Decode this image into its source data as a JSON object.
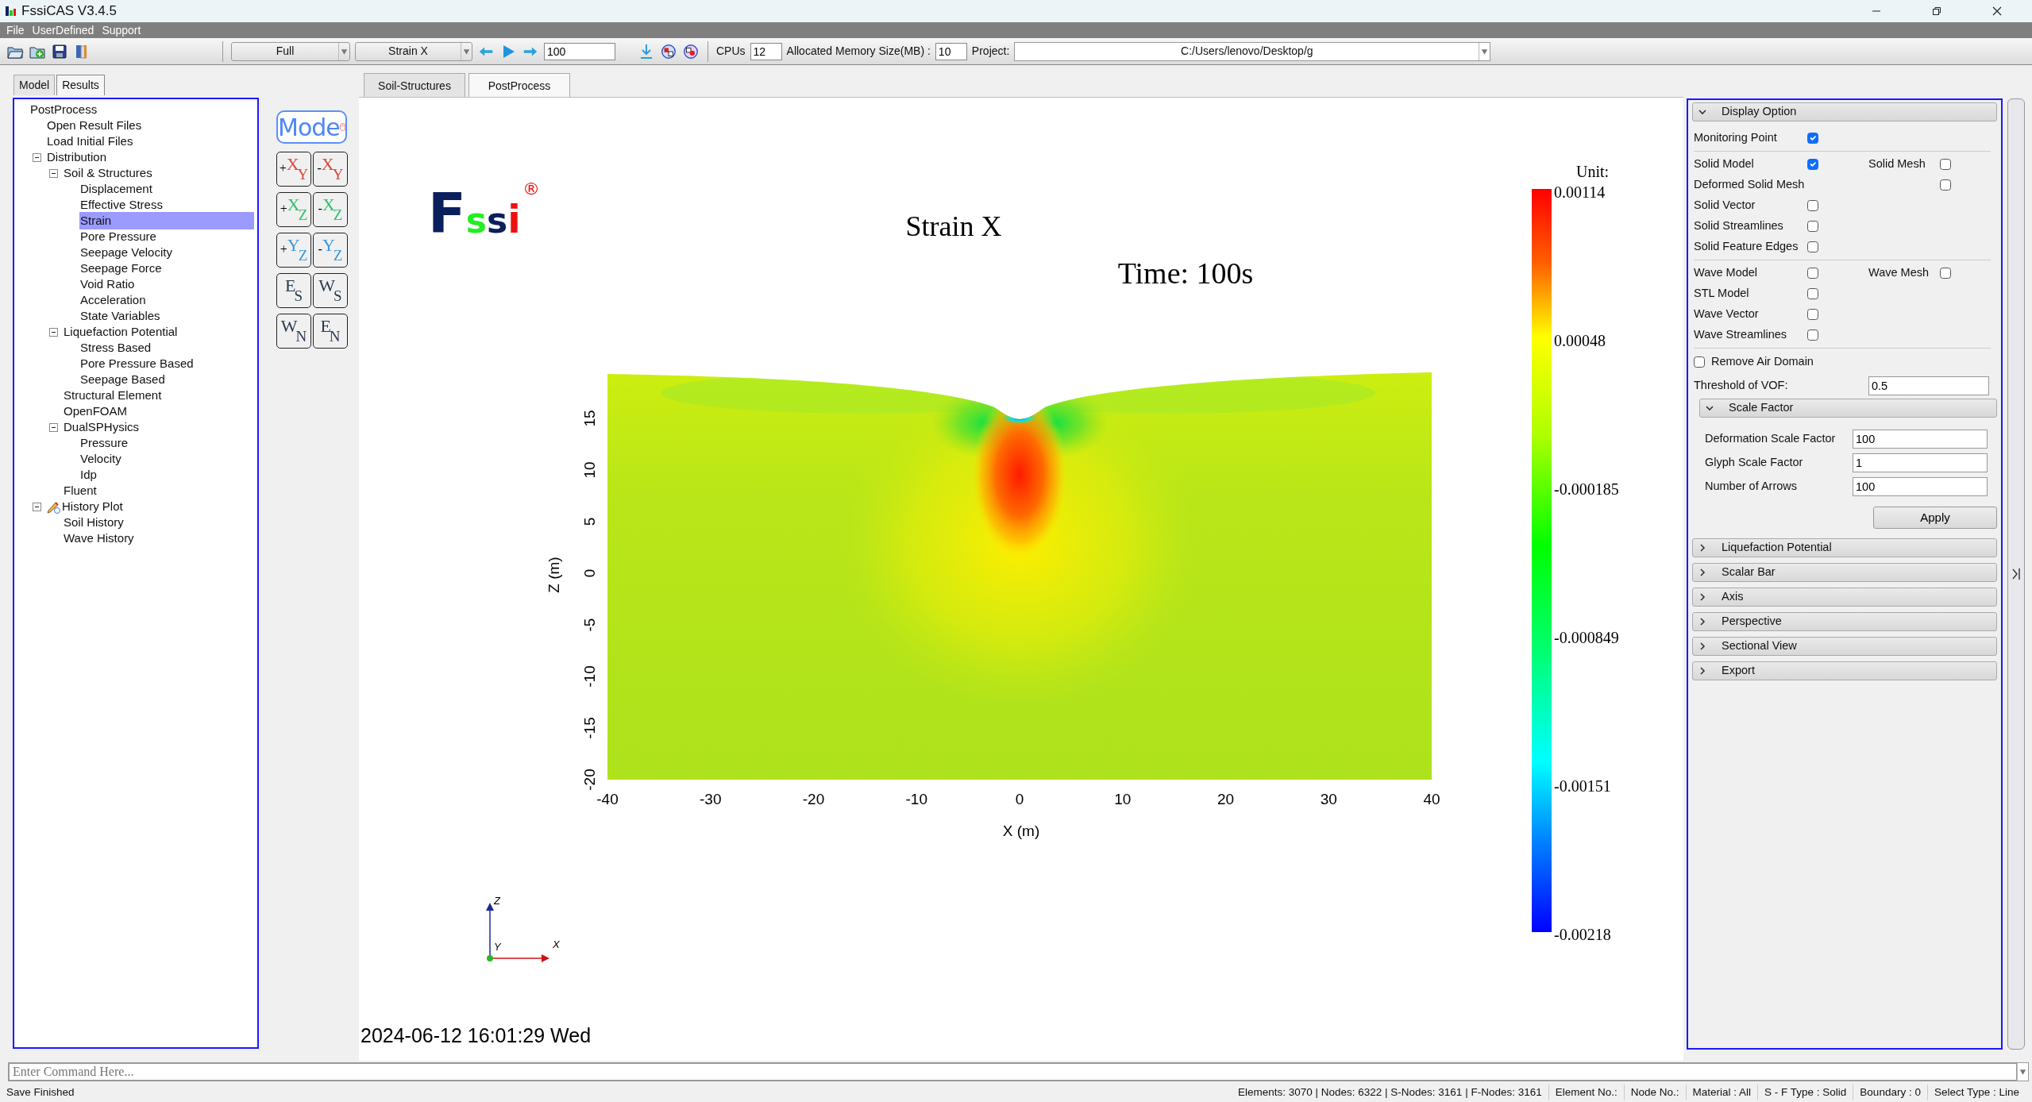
{
  "window": {
    "title": "FssiCAS V3.4.5"
  },
  "menu": [
    "File",
    "UserDefined",
    "Support"
  ],
  "toolbar": {
    "display_mode": "Full",
    "variable": "Strain X",
    "frame": "100",
    "cpus_label": "CPUs",
    "cpus": "12",
    "memory_label": "Allocated Memory Size(MB) :",
    "memory": "10",
    "project_label": "Project:",
    "project": "C:/Users/lenovo/Desktop/g"
  },
  "left_tabs": [
    {
      "label": "Model",
      "selected": false
    },
    {
      "label": "Results",
      "selected": true
    }
  ],
  "tree": [
    {
      "label": "PostProcess",
      "selected": false,
      "children": [
        {
          "label": "Open Result Files",
          "selected": false
        },
        {
          "label": "Load Initial Files",
          "selected": false
        },
        {
          "label": "Distribution",
          "selected": false,
          "expanded": true,
          "children": [
            {
              "label": "Soil & Structures",
              "selected": false,
              "expanded": true,
              "children": [
                {
                  "label": "Displacement",
                  "selected": false
                },
                {
                  "label": "Effective Stress",
                  "selected": false
                },
                {
                  "label": "Strain",
                  "selected": true
                },
                {
                  "label": "Pore Pressure",
                  "selected": false
                },
                {
                  "label": "Seepage Velocity",
                  "selected": false
                },
                {
                  "label": "Seepage Force",
                  "selected": false
                },
                {
                  "label": "Void Ratio",
                  "selected": false
                },
                {
                  "label": "Acceleration",
                  "selected": false
                },
                {
                  "label": "State Variables",
                  "selected": false
                }
              ]
            },
            {
              "label": "Liquefaction Potential",
              "selected": false,
              "expanded": true,
              "children": [
                {
                  "label": "Stress Based",
                  "selected": false
                },
                {
                  "label": "Pore Pressure Based",
                  "selected": false
                },
                {
                  "label": "Seepage Based",
                  "selected": false
                }
              ]
            },
            {
              "label": "Structural Element",
              "selected": false
            },
            {
              "label": "OpenFOAM",
              "selected": false
            },
            {
              "label": "DualSPHysics",
              "selected": false,
              "expanded": true,
              "children": [
                {
                  "label": "Pressure",
                  "selected": false
                },
                {
                  "label": "Velocity",
                  "selected": false
                },
                {
                  "label": "Idp",
                  "selected": false
                }
              ]
            },
            {
              "label": "Fluent",
              "selected": false
            }
          ]
        },
        {
          "label": "History Plot",
          "kind": "plot",
          "selected": false,
          "expanded": true,
          "children": [
            {
              "label": "Soil History",
              "selected": false
            },
            {
              "label": "Wave History",
              "selected": false
            }
          ]
        }
      ]
    }
  ],
  "mode_button": "Mode",
  "view_buttons": [
    {
      "sign": "+",
      "main": "X",
      "sub": "Y",
      "color": "#d9473f"
    },
    {
      "sign": "-",
      "main": "X",
      "sub": "Y",
      "color": "#d9473f"
    },
    {
      "sign": "+",
      "main": "X",
      "sub": "Z",
      "color": "#2fbf6a"
    },
    {
      "sign": "-",
      "main": "X",
      "sub": "Z",
      "color": "#2fbf6a"
    },
    {
      "sign": "+",
      "main": "Y",
      "sub": "Z",
      "color": "#3a98d8"
    },
    {
      "sign": "-",
      "main": "Y",
      "sub": "Z",
      "color": "#3a98d8"
    },
    {
      "main": "E",
      "sub": "S",
      "color": "#2a3a52"
    },
    {
      "main": "W",
      "sub": "S",
      "color": "#2a3a52"
    },
    {
      "main": "W",
      "sub": "N",
      "color": "#2a3a52"
    },
    {
      "main": "E",
      "sub": "N",
      "color": "#2a3a52"
    }
  ],
  "center_tabs": [
    {
      "label": "Soil-Structures",
      "selected": false
    },
    {
      "label": "PostProcess",
      "selected": true
    }
  ],
  "plot": {
    "logo": "Fssi",
    "logo_mark": "®",
    "title": "Strain X",
    "time": "Time: 100s",
    "x_label": "X (m)",
    "z_label": "Z (m)",
    "x_ticks": [
      "-40",
      "-30",
      "-20",
      "-10",
      "0",
      "10",
      "20",
      "30",
      "40"
    ],
    "z_ticks": [
      "-20",
      "-15",
      "-10",
      "-5",
      "0",
      "5",
      "10",
      "15"
    ],
    "colorbar": {
      "title": "Unit:",
      "labels": [
        "0.00114",
        "0.00048",
        "-0.000185",
        "-0.000849",
        "-0.00151",
        "-0.00218"
      ]
    },
    "triad": [
      "Z",
      "Y",
      "X"
    ],
    "timestamp": "2024-06-12 16:01:29 Wed"
  },
  "display_option": {
    "title": "Display Option",
    "expanded": true,
    "rows": [
      {
        "kind": "check",
        "label": "Monitoring Point",
        "checked": true
      },
      {
        "kind": "divider"
      },
      {
        "kind": "check",
        "label": "Solid Model",
        "checked": true,
        "extra": {
          "label": "Solid Mesh",
          "checked": false
        }
      },
      {
        "kind": "check-far",
        "label": "Deformed Solid Mesh",
        "checked": false
      },
      {
        "kind": "check",
        "label": "Solid Vector",
        "checked": false
      },
      {
        "kind": "check",
        "label": "Solid Streamlines",
        "checked": false
      },
      {
        "kind": "check",
        "label": "Solid Feature Edges",
        "checked": false
      },
      {
        "kind": "divider"
      },
      {
        "kind": "check",
        "label": "Wave Model",
        "checked": false,
        "extra": {
          "label": "Wave Mesh",
          "checked": false
        }
      },
      {
        "kind": "check",
        "label": "STL Model",
        "checked": false
      },
      {
        "kind": "check",
        "label": "Wave Vector",
        "checked": false
      },
      {
        "kind": "check",
        "label": "Wave Streamlines",
        "checked": false
      },
      {
        "kind": "divider"
      },
      {
        "kind": "check-left",
        "label": "Remove Air Domain",
        "checked": false
      },
      {
        "kind": "field",
        "label": "Threshold of VOF:",
        "value": "0.5"
      }
    ]
  },
  "scale_factor": {
    "title": "Scale Factor",
    "expanded": true,
    "fields": [
      {
        "label": "Deformation Scale Factor",
        "value": "100"
      },
      {
        "label": "Glyph Scale Factor",
        "value": "1"
      },
      {
        "label": "Number of Arrows",
        "value": "100"
      }
    ],
    "button": "Apply"
  },
  "sections": [
    {
      "title": "Liquefaction Potential",
      "expanded": false
    },
    {
      "title": "Scalar Bar",
      "expanded": false
    },
    {
      "title": "Axis",
      "expanded": false
    },
    {
      "title": "Perspective",
      "expanded": false
    },
    {
      "title": "Sectional View",
      "expanded": false
    },
    {
      "title": "Export",
      "expanded": false
    }
  ],
  "command": {
    "placeholder": "Enter Command Here..."
  },
  "status": {
    "message": "Save Finished",
    "items": [
      "Elements: 3070 | Nodes: 6322 | S-Nodes: 3161 | F-Nodes: 3161",
      "Element No.:",
      "Node No.:",
      "Material :  All",
      "S - F Type :  Solid",
      "Boundary :  0",
      "Select Type :  Line"
    ]
  }
}
